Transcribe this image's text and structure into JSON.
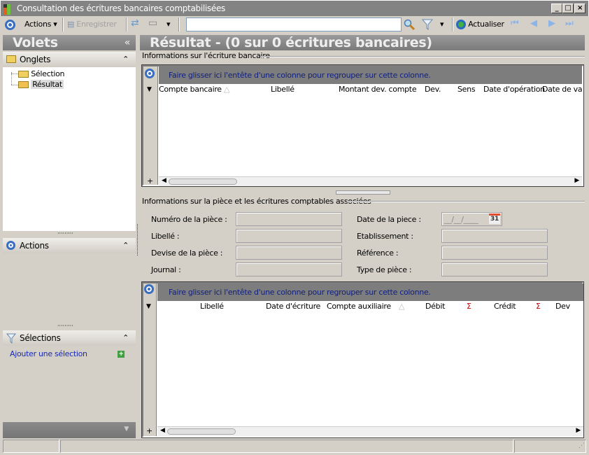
{
  "window": {
    "title": "Consultation des écritures bancaires comptabilisées",
    "min": "_",
    "max": "□",
    "close": "×"
  },
  "toolbar": {
    "actions": "Actions",
    "save": "Enregistrer",
    "search_value": "",
    "refresh": "Actualiser"
  },
  "left": {
    "title": "Volets",
    "collapse": "«",
    "tabs_header": "Onglets",
    "tree": [
      "Sélection",
      "Résultat"
    ],
    "actions_header": "Actions",
    "selections_header": "Sélections",
    "add_selection": "Ajouter une sélection"
  },
  "main": {
    "title": "Résultat - (0 sur 0 écritures bancaires)",
    "bank_section": "Informations sur l'écriture bancaire",
    "group_hint": "Faire glisser ici l'entête d'une colonne pour regrouper sur cette colonne.",
    "bank_columns": [
      "Compte bancaire",
      "Libellé",
      "Montant dev. compte",
      "Dev.",
      "Sens",
      "Date d'opération",
      "Date de valeur"
    ],
    "piece_section": "Informations sur la pièce et les écritures comptables associées",
    "form": {
      "numero": "Numéro de la pièce :",
      "libelle": "Libellé :",
      "devise": "Devise de la pièce :",
      "journal": "Journal :",
      "date": "Date de la piece :",
      "date_value": "__/__/____",
      "cal": "31",
      "etab": "Etablissement :",
      "ref": "Référence :",
      "type": "Type de pièce :"
    },
    "entry_columns": [
      "Libellé",
      "Date d'écriture",
      "Compte auxiliaire",
      "Débit",
      "Crédit",
      "Dev"
    ],
    "sigma": "Σ"
  }
}
